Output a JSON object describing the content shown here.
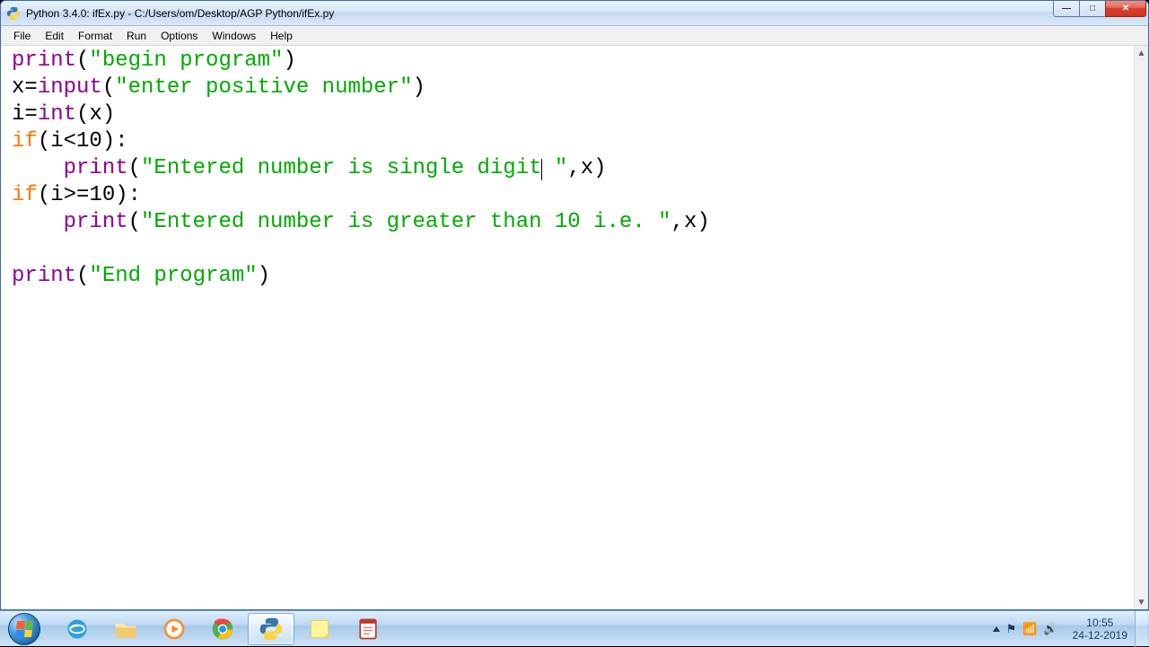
{
  "window": {
    "title": "Python 3.4.0: ifEx.py - C:/Users/om/Desktop/AGP Python/ifEx.py"
  },
  "menubar": {
    "items": [
      "File",
      "Edit",
      "Format",
      "Run",
      "Options",
      "Windows",
      "Help"
    ]
  },
  "code": {
    "tokens": [
      [
        {
          "t": "bi",
          "v": "print"
        },
        {
          "t": "pn",
          "v": "("
        },
        {
          "t": "str",
          "v": "\"begin program\""
        },
        {
          "t": "pn",
          "v": ")"
        }
      ],
      [
        {
          "t": "id",
          "v": "x"
        },
        {
          "t": "op",
          "v": "="
        },
        {
          "t": "bi",
          "v": "input"
        },
        {
          "t": "pn",
          "v": "("
        },
        {
          "t": "str",
          "v": "\"enter positive number\""
        },
        {
          "t": "pn",
          "v": ")"
        }
      ],
      [
        {
          "t": "id",
          "v": "i"
        },
        {
          "t": "op",
          "v": "="
        },
        {
          "t": "bi",
          "v": "int"
        },
        {
          "t": "pn",
          "v": "("
        },
        {
          "t": "id",
          "v": "x"
        },
        {
          "t": "pn",
          "v": ")"
        }
      ],
      [
        {
          "t": "kw",
          "v": "if"
        },
        {
          "t": "pn",
          "v": "("
        },
        {
          "t": "id",
          "v": "i"
        },
        {
          "t": "op",
          "v": "<"
        },
        {
          "t": "id",
          "v": "10"
        },
        {
          "t": "pn",
          "v": ")"
        },
        {
          "t": "op",
          "v": ":"
        }
      ],
      [
        {
          "t": "id",
          "v": "    "
        },
        {
          "t": "bi",
          "v": "print"
        },
        {
          "t": "pn",
          "v": "("
        },
        {
          "t": "str",
          "v": "\"Entered number is single digit"
        },
        {
          "t": "caret",
          "v": ""
        },
        {
          "t": "str",
          "v": " \""
        },
        {
          "t": "pn",
          "v": ","
        },
        {
          "t": "id",
          "v": "x"
        },
        {
          "t": "pn",
          "v": ")"
        }
      ],
      [
        {
          "t": "kw",
          "v": "if"
        },
        {
          "t": "pn",
          "v": "("
        },
        {
          "t": "id",
          "v": "i"
        },
        {
          "t": "op",
          "v": ">="
        },
        {
          "t": "id",
          "v": "10"
        },
        {
          "t": "pn",
          "v": ")"
        },
        {
          "t": "op",
          "v": ":"
        }
      ],
      [
        {
          "t": "id",
          "v": "    "
        },
        {
          "t": "bi",
          "v": "print"
        },
        {
          "t": "pn",
          "v": "("
        },
        {
          "t": "str",
          "v": "\"Entered number is greater than 10 i.e. \""
        },
        {
          "t": "pn",
          "v": ","
        },
        {
          "t": "id",
          "v": "x"
        },
        {
          "t": "pn",
          "v": ")"
        }
      ],
      [],
      [
        {
          "t": "bi",
          "v": "print"
        },
        {
          "t": "pn",
          "v": "("
        },
        {
          "t": "str",
          "v": "\"End program\""
        },
        {
          "t": "pn",
          "v": ")"
        }
      ]
    ]
  },
  "taskbar": {
    "apps": [
      {
        "name": "internet-explorer"
      },
      {
        "name": "file-explorer"
      },
      {
        "name": "windows-media-player"
      },
      {
        "name": "google-chrome"
      },
      {
        "name": "python-idle",
        "active": true
      },
      {
        "name": "sticky-notes"
      },
      {
        "name": "notes-app"
      }
    ]
  },
  "systray": {
    "time": "10:55",
    "date": "24-12-2019"
  }
}
